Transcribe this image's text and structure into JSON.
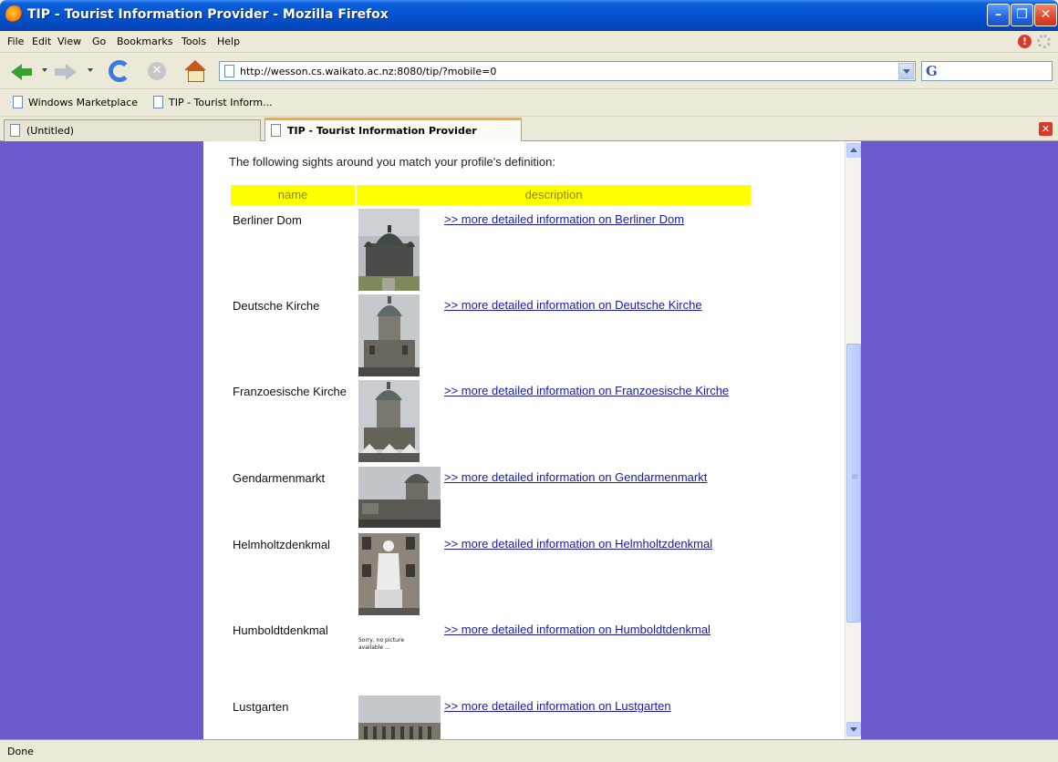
{
  "window": {
    "title": "TIP - Tourist Information Provider - Mozilla Firefox"
  },
  "menu": {
    "items": [
      "File",
      "Edit",
      "View",
      "Go",
      "Bookmarks",
      "Tools",
      "Help"
    ]
  },
  "nav": {
    "url": "http://wesson.cs.waikato.ac.nz:8080/tip/?mobile=0"
  },
  "bookmarks": {
    "items": [
      "Windows Marketplace",
      "TIP - Tourist Inform..."
    ]
  },
  "tabs": [
    {
      "label": "(Untitled)",
      "active": false
    },
    {
      "label": "TIP - Tourist Information Provider",
      "active": true
    }
  ],
  "page": {
    "intro": "The following sights around you match your profile's definition:",
    "table_headers": {
      "name": "name",
      "description": "description"
    },
    "no_picture_text": "Sorry, no picture available ...",
    "sights": [
      {
        "name": "Berliner Dom",
        "link": ">> more detailed information on Berliner Dom",
        "photo": "berliner-dom"
      },
      {
        "name": "Deutsche Kirche",
        "link": ">> more detailed information on Deutsche Kirche",
        "photo": "deutsche-kirche"
      },
      {
        "name": "Franzoesische Kirche",
        "link": ">> more detailed information on Franzoesische Kirche",
        "photo": "franzoesische-kirche"
      },
      {
        "name": "Gendarmenmarkt",
        "link": ">> more detailed information on Gendarmenmarkt",
        "photo": "gendarmenmarkt"
      },
      {
        "name": "Helmholtzdenkmal",
        "link": ">> more detailed information on Helmholtzdenkmal",
        "photo": "helmholtzdenkmal"
      },
      {
        "name": "Humboldtdenkmal",
        "link": ">> more detailed information on Humboldtdenkmal",
        "photo": "none"
      },
      {
        "name": "Lustgarten",
        "link": ">> more detailed information on Lustgarten",
        "photo": "lustgarten"
      }
    ]
  },
  "status": {
    "text": "Done"
  },
  "colors": {
    "page_background": "#6a5acd",
    "table_header": "#ffff00",
    "link": "#1a1aa6"
  }
}
